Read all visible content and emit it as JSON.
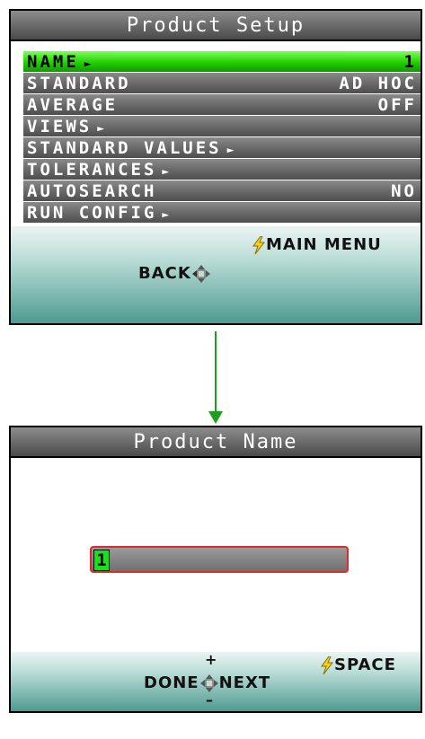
{
  "setup_screen": {
    "title": "Product Setup",
    "menu": [
      {
        "label": "NAME",
        "arrow": "►",
        "value": "1"
      },
      {
        "label": "STANDARD",
        "arrow": "",
        "value": "AD HOC"
      },
      {
        "label": "AVERAGE",
        "arrow": "",
        "value": "OFF"
      },
      {
        "label": "VIEWS",
        "arrow": "►",
        "value": ""
      },
      {
        "label": "STANDARD VALUES",
        "arrow": "►",
        "value": ""
      },
      {
        "label": "TOLERANCES",
        "arrow": "►",
        "value": ""
      },
      {
        "label": "AUTOSEARCH",
        "arrow": "",
        "value": "NO"
      },
      {
        "label": "RUN CONFIG",
        "arrow": "►",
        "value": ""
      }
    ],
    "footer": {
      "main_menu": "MAIN MENU",
      "back": "BACK"
    }
  },
  "name_screen": {
    "title": "Product Name",
    "field_value": "1",
    "footer": {
      "plus": "+",
      "minus": "–",
      "done": "DONE",
      "next": "NEXT",
      "space": "SPACE"
    }
  },
  "colors": {
    "selected": "#22d000",
    "arrow": "#1ca01c",
    "field_border": "#e02b2b"
  },
  "icons": {
    "bolt": "lightning-bolt-icon",
    "dpad": "dpad-icon"
  }
}
